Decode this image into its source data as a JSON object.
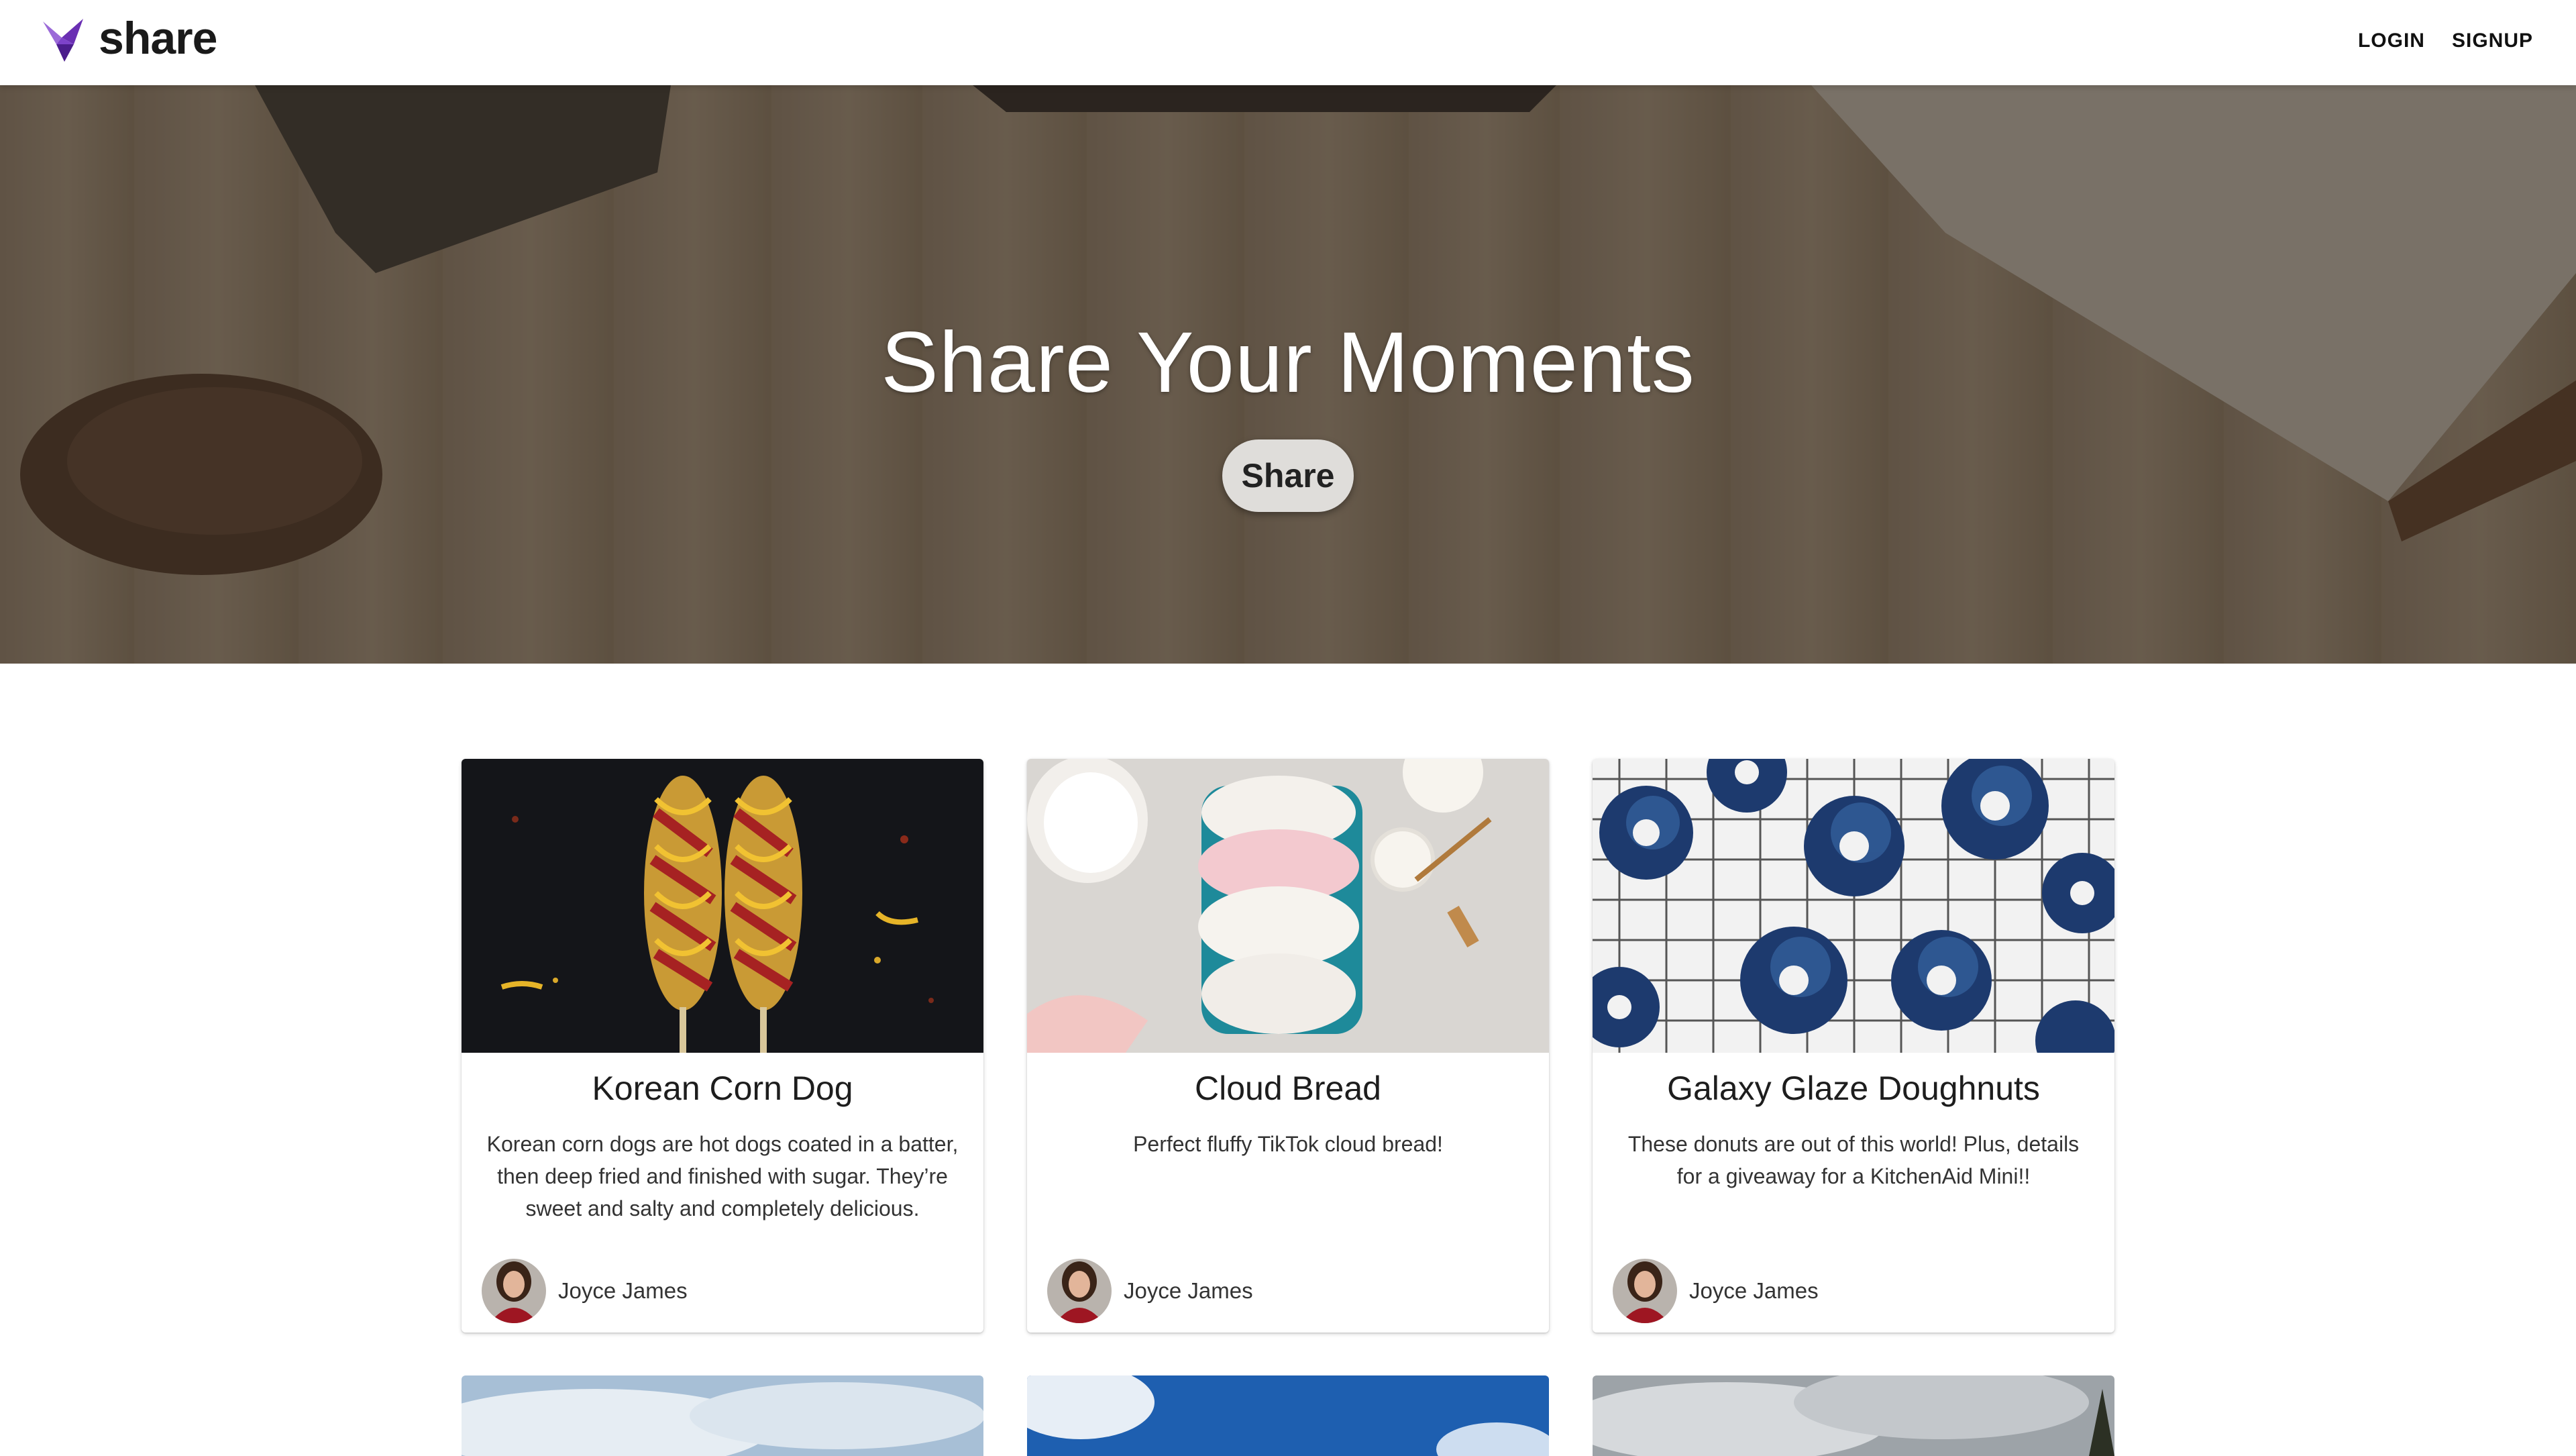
{
  "app": {
    "brand": "share",
    "logo_icon": "bird-logo-icon"
  },
  "nav": {
    "login": "LOGIN",
    "signup": "SIGNUP"
  },
  "hero": {
    "title": "Share Your Moments",
    "button": "Share"
  },
  "colors": {
    "brand_purple": "#7b3fc4",
    "hero_overlay": "#5b5045"
  },
  "cards": [
    {
      "title": "Korean Corn Dog",
      "description": "Korean corn dogs are hot dogs coated in a batter, then deep fried and finished with sugar. They’re sweet and salty and completely delicious.",
      "author": "Joyce James",
      "image_icon": "corn-dog-photo"
    },
    {
      "title": "Cloud Bread",
      "description": "Perfect fluffy TikTok cloud bread!",
      "author": "Joyce James",
      "image_icon": "cloud-bread-photo"
    },
    {
      "title": "Galaxy Glaze Doughnuts",
      "description": "These donuts are out of this world! Plus, details for a giveaway for a KitchenAid Mini!!",
      "author": "Joyce James",
      "image_icon": "doughnuts-photo"
    }
  ],
  "second_row": [
    "sky-photo",
    "blue-sky-photo",
    "cloudy-sky-photo"
  ]
}
